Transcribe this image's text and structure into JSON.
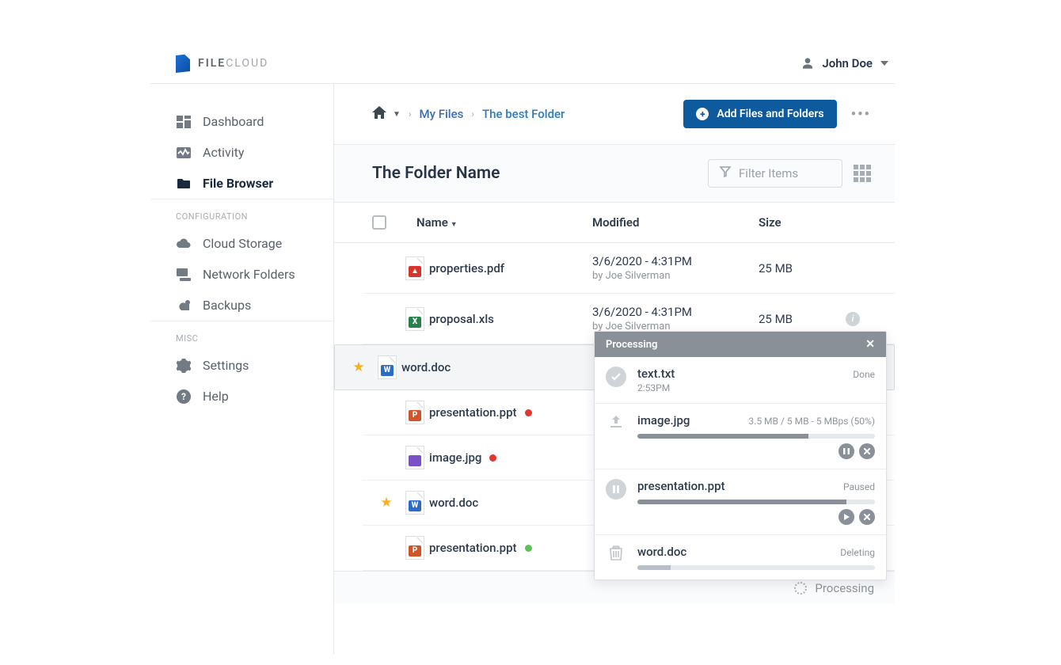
{
  "brand": {
    "text_strong": "FILE",
    "text_light": "CLOUD"
  },
  "user": {
    "name": "John Doe"
  },
  "sidebar": {
    "items": [
      {
        "label": "Dashboard"
      },
      {
        "label": "Activity"
      },
      {
        "label": "File Browser"
      }
    ],
    "section_config": "CONFIGURATION",
    "config_items": [
      {
        "label": "Cloud Storage"
      },
      {
        "label": "Network Folders"
      },
      {
        "label": "Backups"
      }
    ],
    "section_misc": "MISC",
    "misc_items": [
      {
        "label": "Settings"
      },
      {
        "label": "Help"
      }
    ]
  },
  "breadcrumb": {
    "my_files": "My Files",
    "folder": "The best Folder"
  },
  "actions": {
    "add": "Add Files and Folders"
  },
  "title": "The Folder Name",
  "filter": {
    "placeholder": "Filter Items"
  },
  "table": {
    "head": {
      "name": "Name",
      "modified": "Modified",
      "size": "Size"
    },
    "rows": [
      {
        "name": "properties.pdf",
        "type": "pdf",
        "glyph": "▲",
        "modified": "3/6/2020 - 4:31PM",
        "by": "by Joe Silverman",
        "size": "25 MB",
        "star": false,
        "dot": null,
        "hover": false,
        "info": false
      },
      {
        "name": "proposal.xls",
        "type": "xls",
        "glyph": "X",
        "modified": "3/6/2020 - 4:31PM",
        "by": "by Joe Silverman",
        "size": "25 MB",
        "star": false,
        "dot": null,
        "hover": false,
        "info": true
      },
      {
        "name": "word.doc",
        "type": "doc",
        "glyph": "W",
        "modified": "",
        "by": "",
        "size": "",
        "star": true,
        "dot": null,
        "hover": true,
        "info": false
      },
      {
        "name": "presentation.ppt",
        "type": "ppt",
        "glyph": "P",
        "modified": "",
        "by": "",
        "size": "",
        "star": false,
        "dot": "red",
        "hover": false,
        "info": false
      },
      {
        "name": "image.jpg",
        "type": "img",
        "glyph": "",
        "modified": "",
        "by": "",
        "size": "",
        "star": false,
        "dot": "red",
        "hover": false,
        "info": false
      },
      {
        "name": "word.doc",
        "type": "doc",
        "glyph": "W",
        "modified": "",
        "by": "",
        "size": "",
        "star": true,
        "dot": null,
        "hover": false,
        "info": false
      },
      {
        "name": "presentation.ppt",
        "type": "ppt",
        "glyph": "P",
        "modified": "",
        "by": "",
        "size": "",
        "star": false,
        "dot": "green",
        "hover": false,
        "info": false
      }
    ]
  },
  "processing": {
    "title": "Processing",
    "items": [
      {
        "kind": "done",
        "name": "text.txt",
        "sub": "2:53PM",
        "right": "Done"
      },
      {
        "kind": "uploading",
        "name": "image.jpg",
        "right": "3.5 MB / 5 MB - 5 MBps (50%)",
        "pct": 72
      },
      {
        "kind": "paused",
        "name": "presentation.ppt",
        "right": "Paused",
        "pct": 88
      },
      {
        "kind": "deleting",
        "name": "word.doc",
        "right": "Deleting",
        "pct": 14
      }
    ]
  },
  "footer": {
    "label": "Processing"
  }
}
